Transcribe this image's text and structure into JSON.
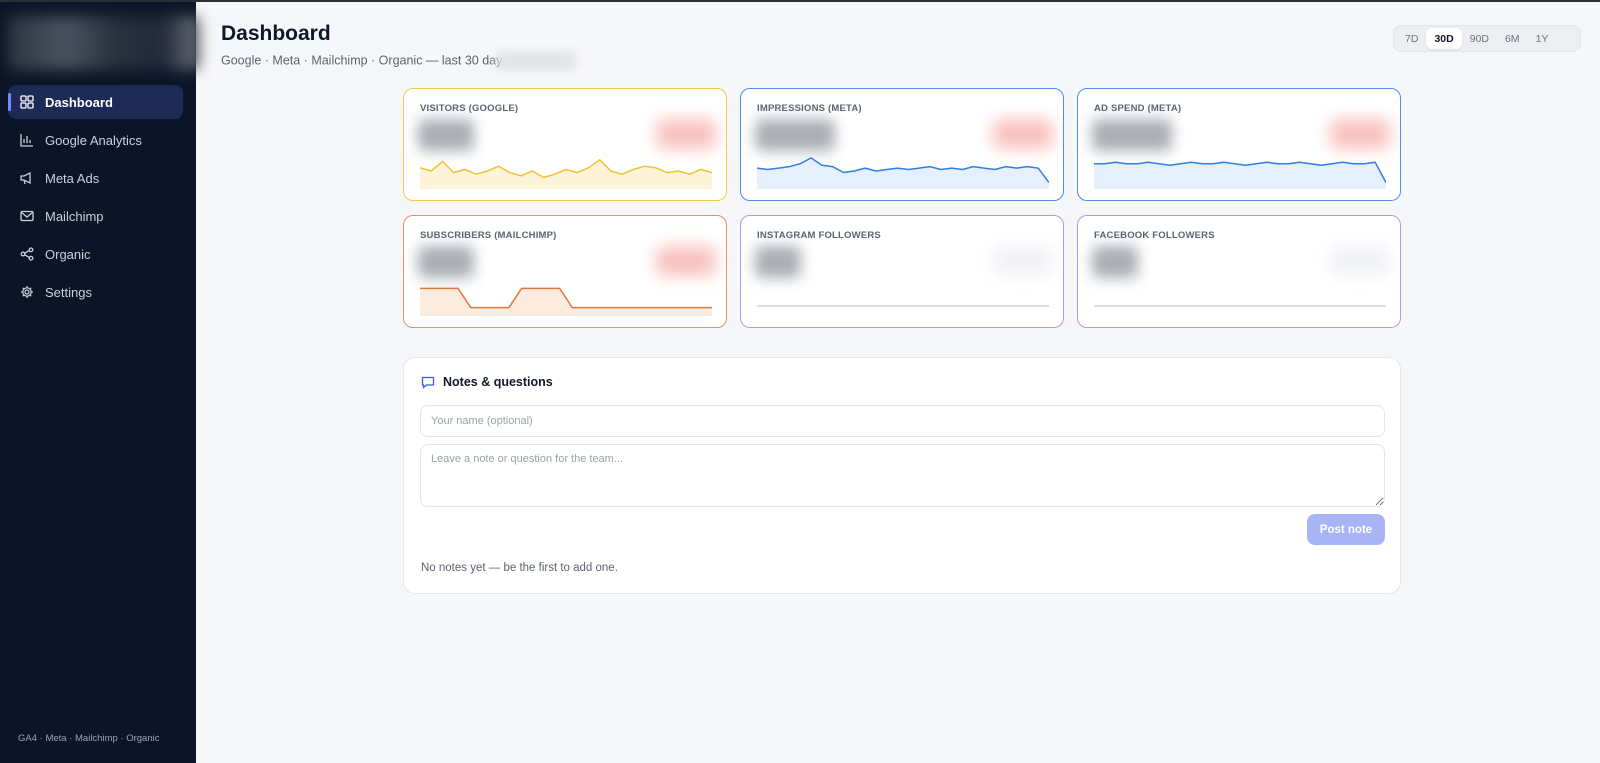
{
  "sidebar": {
    "items": [
      {
        "label": "Dashboard",
        "icon": "grid-icon"
      },
      {
        "label": "Google Analytics",
        "icon": "bar-chart-icon"
      },
      {
        "label": "Meta Ads",
        "icon": "megaphone-icon"
      },
      {
        "label": "Mailchimp",
        "icon": "mail-icon"
      },
      {
        "label": "Organic",
        "icon": "share-icon"
      },
      {
        "label": "Settings",
        "icon": "gear-icon"
      }
    ],
    "active_index": 0,
    "footer": "GA4 · Meta · Mailchimp · Organic"
  },
  "header": {
    "title": "Dashboard",
    "subtitle": "Google · Meta · Mailchimp · Organic — last 30 day"
  },
  "ranges": {
    "options": [
      "7D",
      "30D",
      "90D",
      "6M",
      "1Y"
    ],
    "selected": "30D"
  },
  "cards": [
    {
      "label": "VISITORS (GOOGLE)",
      "border_color": "#f2c94c",
      "line_color": "#f2c230",
      "fill_color": "#fdf3d8",
      "badge_color": "#f6b2ad"
    },
    {
      "label": "IMPRESSIONS (META)",
      "border_color": "#4a8ee8",
      "line_color": "#2f7fe0",
      "fill_color": "#e6f0fc",
      "badge_color": "#f6b2ad"
    },
    {
      "label": "AD SPEND (META)",
      "border_color": "#4a8ee8",
      "line_color": "#2f7fe0",
      "fill_color": "#e6f0fc",
      "badge_color": "#f6b2ad"
    },
    {
      "label": "SUBSCRIBERS (MAILCHIMP)",
      "border_color": "#e89060",
      "line_color": "#e2773c",
      "fill_color": "#fcebdf",
      "badge_color": "#f6b2ad"
    },
    {
      "label": "INSTAGRAM FOLLOWERS",
      "border_color": "#b19ae8",
      "line_color": "#cfd3da",
      "fill_color": "#ffffff",
      "badge_color": "#eceef2"
    },
    {
      "label": "FACEBOOK FOLLOWERS",
      "border_color": "#b19ae8",
      "line_color": "#cfd3da",
      "fill_color": "#ffffff",
      "badge_color": "#eceef2"
    }
  ],
  "chart_data": [
    {
      "type": "area",
      "series": [
        {
          "values": [
            12,
            10,
            16,
            9,
            11,
            8,
            10,
            13,
            9,
            7,
            10,
            6,
            8,
            11,
            9,
            12,
            17,
            10,
            8,
            11,
            13,
            12,
            9,
            10,
            8,
            11,
            9
          ]
        }
      ],
      "ylim": [
        0,
        20
      ]
    },
    {
      "type": "area",
      "series": [
        {
          "values": [
            13,
            12,
            13,
            14,
            16,
            20,
            15,
            14,
            10,
            11,
            13,
            11,
            12,
            13,
            12,
            13,
            14,
            12,
            13,
            12,
            14,
            13,
            12,
            14,
            13,
            14,
            13,
            3
          ]
        }
      ],
      "ylim": [
        0,
        22
      ]
    },
    {
      "type": "area",
      "series": [
        {
          "values": [
            16,
            16,
            17,
            16,
            16,
            17,
            16,
            15,
            16,
            17,
            16,
            16,
            17,
            16,
            15,
            16,
            17,
            16,
            16,
            17,
            16,
            15,
            16,
            17,
            16,
            16,
            17,
            3
          ]
        }
      ],
      "ylim": [
        0,
        22
      ]
    },
    {
      "type": "area",
      "series": [
        {
          "values": [
            3,
            3,
            3,
            3,
            0,
            0,
            0,
            0,
            3,
            3,
            3,
            3,
            0,
            0,
            0,
            0,
            0,
            0,
            0,
            0,
            0,
            0,
            0,
            0
          ]
        }
      ],
      "ylim": [
        -1,
        4
      ]
    },
    {
      "type": "line",
      "series": [
        {
          "values": [
            1,
            1,
            1,
            1,
            1,
            1,
            1,
            1,
            1,
            1
          ]
        }
      ],
      "ylim": [
        0,
        4
      ]
    },
    {
      "type": "line",
      "series": [
        {
          "values": [
            1,
            1,
            1,
            1,
            1,
            1,
            1,
            1,
            1,
            1
          ]
        }
      ],
      "ylim": [
        0,
        4
      ]
    }
  ],
  "notes": {
    "title": "Notes & questions",
    "name_placeholder": "Your name (optional)",
    "note_placeholder": "Leave a note or question for the team...",
    "post_label": "Post note",
    "empty_message": "No notes yet — be the first to add one."
  }
}
